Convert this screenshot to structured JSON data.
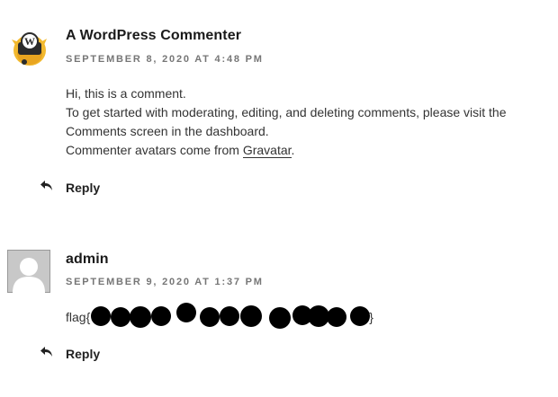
{
  "comments": [
    {
      "author": "A WordPress Commenter",
      "date": "September 8, 2020 at 4:48 pm",
      "avatar_icon": "wordpress-logo-avatar",
      "lines": [
        "Hi, this is a comment.",
        "To get started with moderating, editing, and deleting comments, please visit the",
        "Comments screen in the dashboard."
      ],
      "line4_prefix": "Commenter avatars come from ",
      "line4_link": "Gravatar",
      "line4_suffix": ".",
      "reply_label": "Reply"
    },
    {
      "author": "admin",
      "date": "September 9, 2020 at 1:37 pm",
      "avatar_icon": "default-person-avatar",
      "text_prefix": "flag{",
      "text_suffix": "}",
      "redaction_note": "content obscured by black dots",
      "reply_label": "Reply"
    }
  ],
  "colors": {
    "text": "#333333",
    "meta": "#767676",
    "avatar_bg": "#c8c8c8",
    "wp_badge": "#f2b92f"
  }
}
